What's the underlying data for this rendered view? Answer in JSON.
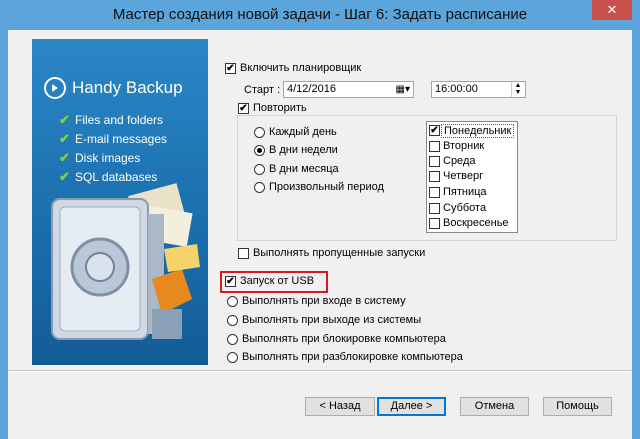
{
  "window": {
    "title": "Мастер создания новой задачи - Шаг 6: Задать расписание",
    "close_glyph": "✕"
  },
  "banner": {
    "brand": "Handy Backup",
    "features": [
      "Files and folders",
      "E-mail messages",
      "Disk images",
      "SQL databases"
    ]
  },
  "scheduler": {
    "enable_label": "Включить планировщик",
    "enable_checked": true,
    "start_label": "Старт :",
    "start_date": "4/12/2016",
    "start_time": "16:00:00",
    "repeat_label": "Повторить",
    "repeat_checked": true
  },
  "repeat_options": [
    {
      "label": "Каждый день",
      "selected": false
    },
    {
      "label": "В дни недели",
      "selected": true
    },
    {
      "label": "В дни месяца",
      "selected": false
    },
    {
      "label": "Произвольный период",
      "selected": false
    }
  ],
  "weekdays": [
    {
      "label": "Понедельник",
      "checked": true
    },
    {
      "label": "Вторник",
      "checked": false
    },
    {
      "label": "Среда",
      "checked": false
    },
    {
      "label": "Четверг",
      "checked": false
    },
    {
      "label": "Пятница",
      "checked": false
    },
    {
      "label": "Суббота",
      "checked": false
    },
    {
      "label": "Воскресенье",
      "checked": false
    }
  ],
  "run_missed": {
    "label": "Выполнять пропущенные запуски",
    "checked": false
  },
  "usb": {
    "label": "Запуск от USB",
    "checked": true
  },
  "triggers": [
    "Выполнять при входе в систему",
    "Выполнять при выходе из системы",
    "Выполнять при блокировке компьютера",
    "Выполнять при разблокировке компьютера"
  ],
  "buttons": {
    "back": "< Назад",
    "next": "Далее >",
    "cancel": "Отмена",
    "help": "Помощь"
  },
  "colors": {
    "title_bar": "#5ba5da",
    "banner": "#1b6fae",
    "highlight": "#d9171f",
    "check_green": "#86d13a"
  }
}
